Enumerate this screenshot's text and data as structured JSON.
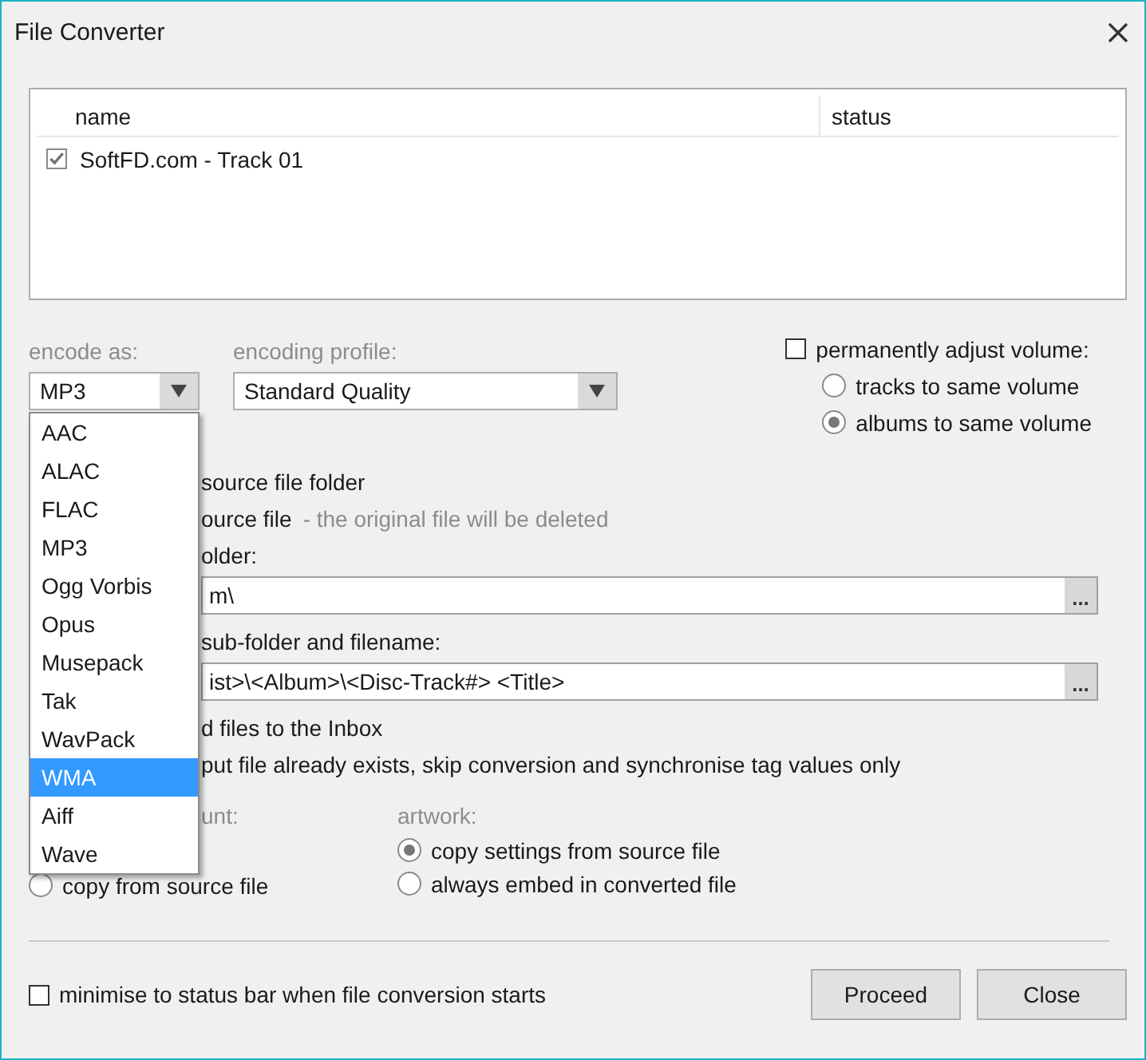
{
  "window": {
    "title": "File Converter"
  },
  "file_list": {
    "columns": [
      "name",
      "status"
    ],
    "rows": [
      {
        "name": "SoftFD.com - Track 01",
        "checked": true
      }
    ]
  },
  "encode_as": {
    "label": "encode as:",
    "value": "MP3",
    "expanded": true,
    "options": [
      {
        "label": "AAC",
        "highlighted": false
      },
      {
        "label": "ALAC",
        "highlighted": false
      },
      {
        "label": "FLAC",
        "highlighted": false
      },
      {
        "label": "MP3",
        "highlighted": false
      },
      {
        "label": "Ogg Vorbis",
        "highlighted": false
      },
      {
        "label": "Opus",
        "highlighted": false
      },
      {
        "label": "Musepack",
        "highlighted": false
      },
      {
        "label": "Tak",
        "highlighted": false
      },
      {
        "label": "WavPack",
        "highlighted": false
      },
      {
        "label": "WMA",
        "highlighted": true
      },
      {
        "label": "Aiff",
        "highlighted": false
      },
      {
        "label": "Wave",
        "highlighted": false
      }
    ]
  },
  "encoding_profile": {
    "label": "encoding profile:",
    "value": "Standard Quality"
  },
  "volume": {
    "label": "permanently adjust volume:",
    "checked": false,
    "options": [
      {
        "label": "tracks to same volume",
        "selected": false
      },
      {
        "label": "albums to same volume",
        "selected": true
      }
    ]
  },
  "output": [
    {
      "kind": "text",
      "text": "source file folder"
    },
    {
      "kind": "note",
      "text": "ource file",
      "note": "- the original file will be deleted"
    },
    {
      "kind": "text",
      "text": "older:"
    },
    {
      "kind": "field",
      "value": "m\\",
      "button": "..."
    },
    {
      "kind": "text",
      "text": "sub-folder and filename:"
    },
    {
      "kind": "field",
      "value": "ist>\\<Album>\\<Disc-Track#> <Title>",
      "button": "..."
    },
    {
      "kind": "text",
      "text": "d files to the Inbox"
    },
    {
      "kind": "text",
      "text": "put file already exists, skip conversion and synchronise tag values only"
    }
  ],
  "left_group": {
    "label": "unt:",
    "options": [
      {
        "label": "copy from source file",
        "selected": false
      }
    ]
  },
  "artwork": {
    "label": "artwork:",
    "options": [
      {
        "label": "copy settings from source file",
        "selected": true
      },
      {
        "label": "always embed in converted file",
        "selected": false
      }
    ]
  },
  "footer": {
    "minimise": {
      "label": "minimise to status bar when file conversion starts",
      "checked": false
    },
    "buttons": [
      "Proceed",
      "Close"
    ]
  }
}
